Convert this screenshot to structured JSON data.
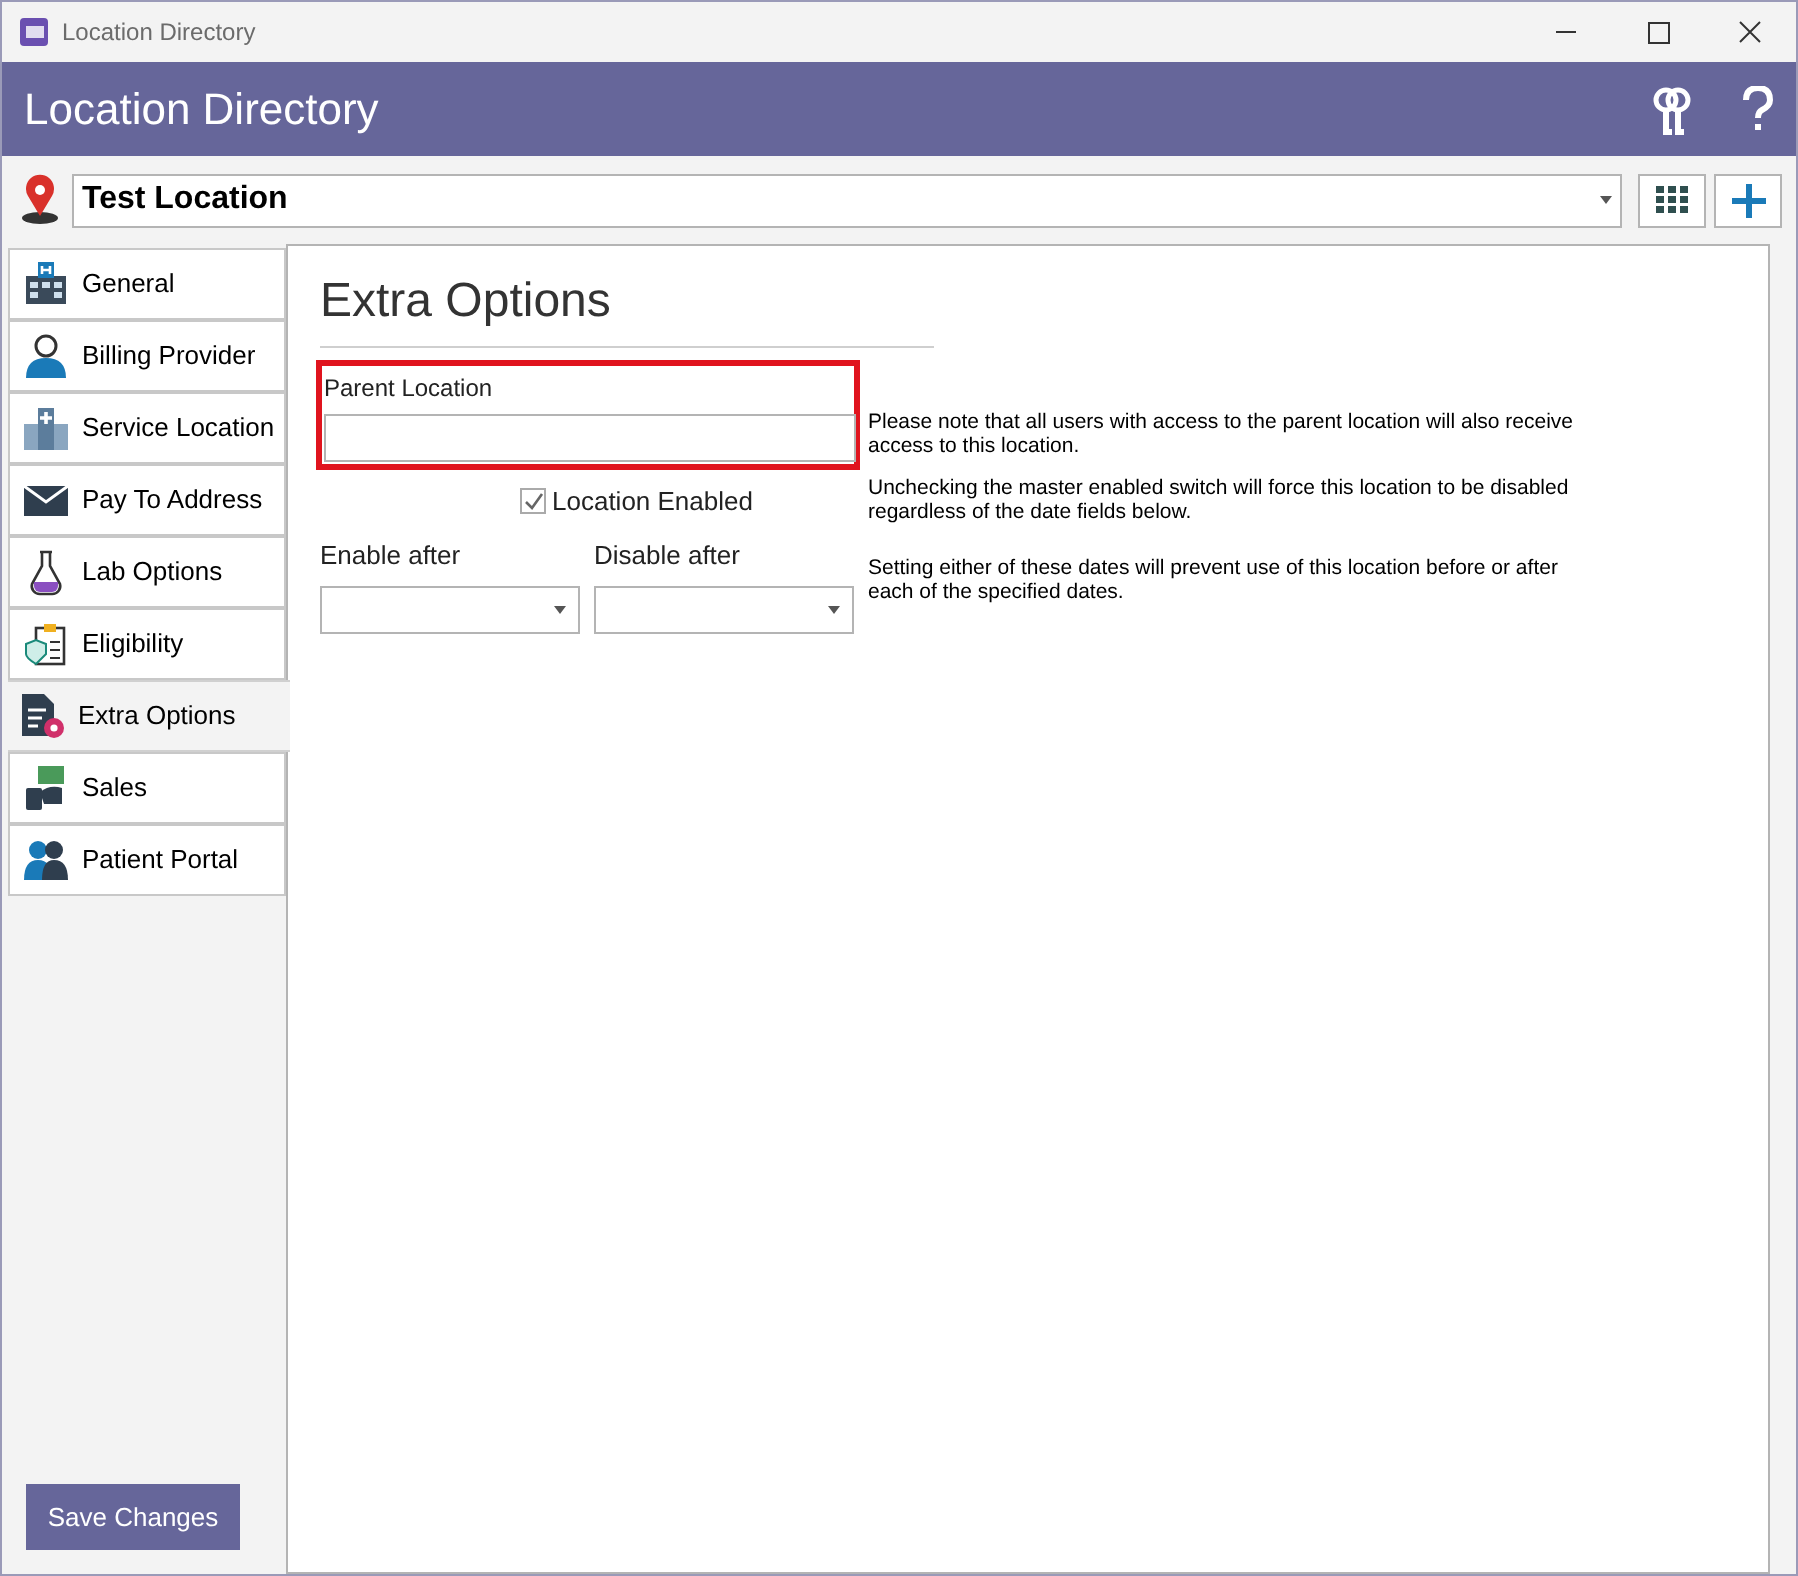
{
  "window": {
    "title": "Location Directory"
  },
  "header": {
    "title": "Location Directory"
  },
  "location_picker": {
    "value": "Test Location"
  },
  "tabs": [
    {
      "label": "General",
      "selected": false
    },
    {
      "label": "Billing Provider",
      "selected": false
    },
    {
      "label": "Service Location",
      "selected": false
    },
    {
      "label": "Pay To Address",
      "selected": false
    },
    {
      "label": "Lab Options",
      "selected": false
    },
    {
      "label": "Eligibility",
      "selected": false
    },
    {
      "label": "Extra Options",
      "selected": true
    },
    {
      "label": "Sales",
      "selected": false
    },
    {
      "label": "Patient Portal",
      "selected": false
    }
  ],
  "save_button": "Save Changes",
  "panel": {
    "title": "Extra Options",
    "parent_location": {
      "label": "Parent Location",
      "highlighted": true
    },
    "parent_note": "Please note that all users with access to the parent location will also receive access to this location.",
    "location_enabled": {
      "label": "Location Enabled",
      "checked": true
    },
    "enabled_note": "Unchecking the master enabled switch will force this location to be disabled regardless of the date fields below.",
    "enable_after": {
      "label": "Enable after"
    },
    "disable_after": {
      "label": "Disable after"
    },
    "dates_note": "Setting either of these dates will prevent use of this location before or after each of the specified dates."
  }
}
